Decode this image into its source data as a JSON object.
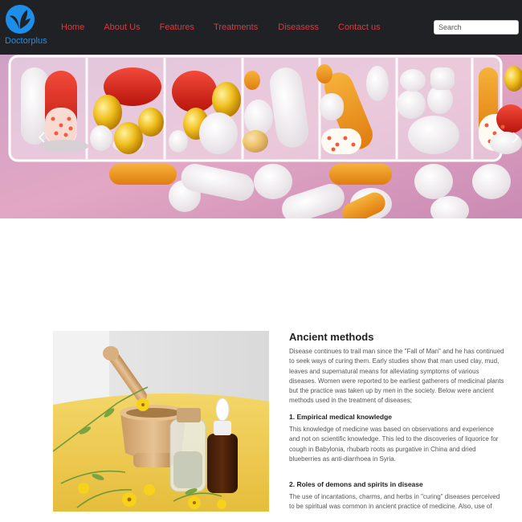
{
  "brand": {
    "name": "Doctorplus",
    "color": "#1e8ee8"
  },
  "nav": {
    "items": [
      {
        "label": "Home"
      },
      {
        "label": "About Us"
      },
      {
        "label": "Features"
      },
      {
        "label": "Treatments"
      },
      {
        "label": "Diseasess"
      },
      {
        "label": "Contact us"
      }
    ],
    "color": "#e0373c"
  },
  "search": {
    "placeholder": "Search",
    "value": ""
  },
  "carousel": {
    "prev_icon": "chevron-left-icon",
    "next_icon": "chevron-right-icon"
  },
  "article": {
    "title": "Ancient methods",
    "intro": "Disease continues to trail man since the \"Fall of Man\" and he has continued to seek ways of curing them. Early studies show that man used clay, mud, leaves and supernatural means for alleviating symptoms of various diseases. Women were reported to be earliest gatherers of medicinal plants but the practice was taken up by men in the society. Below were ancient methods used in the treatment of diseases;",
    "sections": [
      {
        "heading": "1. Empirical medical knowledge",
        "body": "This knowledge of medicine was based on observations and experience and not on scientific knowledge. This led to the discoveries of liquorice for cough in Babylonia, rhubarb roots as purgative in China and dried blueberries as anti-diarrhoea in Syria."
      },
      {
        "heading": "2. Roles of demons and spirits in disease",
        "body": "The use of incantations, charms, and herbs in \"curing\" diseases perceived to be spiritual was common in ancient practice of medicine. Also, use of"
      }
    ]
  },
  "colors": {
    "header_bg": "#1f2125",
    "accent": "#e0373c",
    "brand": "#1e8ee8"
  }
}
